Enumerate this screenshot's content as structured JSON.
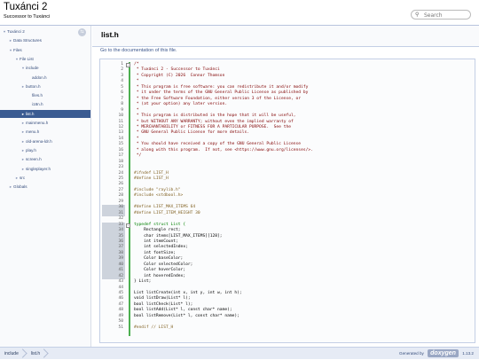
{
  "header": {
    "project_name": "Tuxánci 2",
    "project_brief": "Successor to Tuxánci",
    "search_placeholder": "Search"
  },
  "nav_tree": [
    {
      "label": "Tuxánci 2",
      "arrow": "▼",
      "depth": 0
    },
    {
      "label": "Data Structures",
      "arrow": "►",
      "depth": 1
    },
    {
      "label": "Files",
      "arrow": "▼",
      "depth": 1
    },
    {
      "label": "File List",
      "arrow": "▼",
      "depth": 2
    },
    {
      "label": "include",
      "arrow": "▼",
      "depth": 3
    },
    {
      "label": "addon.h",
      "arrow": "",
      "depth": 4
    },
    {
      "label": "button.h",
      "arrow": "►",
      "depth": 3
    },
    {
      "label": "files.h",
      "arrow": "",
      "depth": 4
    },
    {
      "label": "i18n.h",
      "arrow": "",
      "depth": 4
    },
    {
      "label": "list.h",
      "arrow": "►",
      "depth": 3,
      "selected": true
    },
    {
      "label": "mainmenu.h",
      "arrow": "►",
      "depth": 3
    },
    {
      "label": "menu.h",
      "arrow": "►",
      "depth": 3
    },
    {
      "label": "old-arena-ldr.h",
      "arrow": "►",
      "depth": 3
    },
    {
      "label": "play.h",
      "arrow": "►",
      "depth": 3
    },
    {
      "label": "screen.h",
      "arrow": "►",
      "depth": 3
    },
    {
      "label": "singleplayer.h",
      "arrow": "►",
      "depth": 3
    },
    {
      "label": "src",
      "arrow": "►",
      "depth": 2
    },
    {
      "label": "Globals",
      "arrow": "►",
      "depth": 1
    }
  ],
  "page": {
    "title": "list.h",
    "doc_link": "Go to the documentation of this file."
  },
  "code_lines": [
    {
      "n": "1",
      "fold": "-",
      "text": "/*",
      "cls": "c-cm"
    },
    {
      "n": "2",
      "text": " * Tuxánci 2 - Successor to Tuxánci",
      "cls": "c-cm"
    },
    {
      "n": "3",
      "text": " * Copyright (C) 2026  Connor Thomson",
      "cls": "c-cm"
    },
    {
      "n": "4",
      "text": " *",
      "cls": "c-cm"
    },
    {
      "n": "5",
      "text": " * This program is free software: you can redistribute it and/or modify",
      "cls": "c-cm"
    },
    {
      "n": "6",
      "text": " * it under the terms of the GNU General Public License as published by",
      "cls": "c-cm"
    },
    {
      "n": "7",
      "text": " * the Free Software Foundation, either version 3 of the License, or",
      "cls": "c-cm"
    },
    {
      "n": "8",
      "text": " * (at your option) any later version.",
      "cls": "c-cm"
    },
    {
      "n": "9",
      "text": " *",
      "cls": "c-cm"
    },
    {
      "n": "10",
      "text": " * This program is distributed in the hope that it will be useful,",
      "cls": "c-cm"
    },
    {
      "n": "11",
      "text": " * but WITHOUT ANY WARRANTY; without even the implied warranty of",
      "cls": "c-cm"
    },
    {
      "n": "12",
      "text": " * MERCHANTABILITY or FITNESS FOR A PARTICULAR PURPOSE.  See the",
      "cls": "c-cm"
    },
    {
      "n": "13",
      "text": " * GNU General Public License for more details.",
      "cls": "c-cm"
    },
    {
      "n": "14",
      "text": " *",
      "cls": "c-cm"
    },
    {
      "n": "15",
      "text": " * You should have received a copy of the GNU General Public License",
      "cls": "c-cm"
    },
    {
      "n": "16",
      "text": " * along with this program.  If not, see <https://www.gnu.org/licenses/>.",
      "cls": "c-cm"
    },
    {
      "n": "17",
      "text": " */",
      "cls": "c-cm"
    },
    {
      "n": "18",
      "text": "",
      "cls": "c-id"
    },
    {
      "n": "23",
      "text": "",
      "cls": "c-id"
    },
    {
      "n": "24",
      "text": "#ifndef LIST_H",
      "cls": "c-pp"
    },
    {
      "n": "25",
      "text": "#define LIST_H",
      "cls": "c-pp"
    },
    {
      "n": "26",
      "text": "",
      "cls": "c-id"
    },
    {
      "n": "27",
      "text": "#include \"raylib.h\"",
      "cls": "c-pp"
    },
    {
      "n": "28",
      "text": "#include <stdbool.h>",
      "cls": "c-pp"
    },
    {
      "n": "29",
      "text": "",
      "cls": "c-id"
    },
    {
      "n": "30",
      "hl": true,
      "text": "#define LIST_MAX_ITEMS 64",
      "cls": "c-pp"
    },
    {
      "n": "31",
      "hl": true,
      "text": "#define LIST_ITEM_HEIGHT 30",
      "cls": "c-pp"
    },
    {
      "n": "32",
      "text": "",
      "cls": "c-id"
    },
    {
      "n": "33",
      "hl": true,
      "fold": "-",
      "text": "typedef struct List {",
      "cls": "c-kw"
    },
    {
      "n": "34",
      "hl": true,
      "text": "    Rectangle rect;",
      "cls": "c-id"
    },
    {
      "n": "35",
      "hl": true,
      "text": "    char items[LIST_MAX_ITEMS][128];",
      "cls": "c-id"
    },
    {
      "n": "36",
      "hl": true,
      "text": "    int itemCount;",
      "cls": "c-id"
    },
    {
      "n": "37",
      "hl": true,
      "text": "    int selectedIndex;",
      "cls": "c-id"
    },
    {
      "n": "38",
      "hl": true,
      "text": "    int fontSize;",
      "cls": "c-id"
    },
    {
      "n": "39",
      "hl": true,
      "text": "    Color baseColor;",
      "cls": "c-id"
    },
    {
      "n": "40",
      "hl": true,
      "text": "    Color selectedColor;",
      "cls": "c-id"
    },
    {
      "n": "41",
      "hl": true,
      "text": "    Color hoverColor;",
      "cls": "c-id"
    },
    {
      "n": "42",
      "hl": true,
      "text": "    int hoveredIndex;",
      "cls": "c-id"
    },
    {
      "n": "43",
      "text": "} List;",
      "cls": "c-id"
    },
    {
      "n": "44",
      "text": "",
      "cls": "c-id"
    },
    {
      "n": "45",
      "text": "List listCreate(int x, int y, int w, int h);",
      "cls": "c-id"
    },
    {
      "n": "46",
      "text": "void listDraw(List* l);",
      "cls": "c-id"
    },
    {
      "n": "47",
      "text": "bool listCheck(List* l);",
      "cls": "c-id"
    },
    {
      "n": "48",
      "text": "bool listAdd(List* l, const char* name);",
      "cls": "c-id"
    },
    {
      "n": "49",
      "text": "bool listRemove(List* l, const char* name);",
      "cls": "c-id"
    },
    {
      "n": "50",
      "text": "",
      "cls": "c-id"
    },
    {
      "n": "51",
      "text": "#endif // LIST_H",
      "cls": "c-pp"
    }
  ],
  "footer": {
    "breadcrumbs": [
      "include",
      "list.h"
    ],
    "generated_by": "Generated by",
    "generator": "doxygen",
    "version": "1.13.2"
  },
  "colors": {
    "selected_bg": "#3a5b92",
    "link": "#3d578c",
    "comment": "#800000",
    "preprocessor": "#806020",
    "keyword": "#008000",
    "fold_guide": "#4caf50"
  }
}
